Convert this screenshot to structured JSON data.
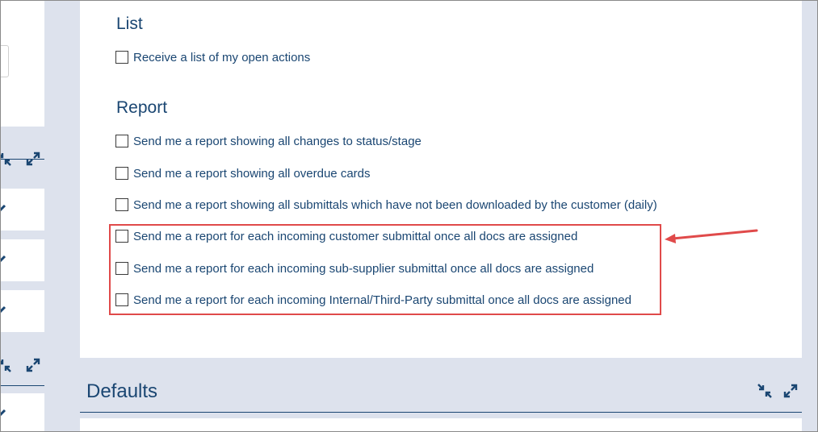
{
  "list_section": {
    "title": "List",
    "options": [
      {
        "label": "Receive a list of my open actions",
        "checked": false
      }
    ]
  },
  "report_section": {
    "title": "Report",
    "options": [
      {
        "label": "Send me a report showing all changes to status/stage",
        "checked": false
      },
      {
        "label": "Send me a report showing all overdue cards",
        "checked": false
      },
      {
        "label": "Send me a report showing all submittals which have not been downloaded by the customer (daily)",
        "checked": false
      },
      {
        "label": "Send me a report for each incoming customer submittal once all docs are assigned",
        "checked": false
      },
      {
        "label": "Send me a report for each incoming sub-supplier submittal once all docs are assigned",
        "checked": false
      },
      {
        "label": "Send me a report for each incoming Internal/Third-Party submittal once all docs are assigned",
        "checked": false
      }
    ]
  },
  "defaults_section": {
    "title": "Defaults"
  },
  "icons": {
    "collapse": "collapse-icon",
    "expand": "expand-icon",
    "edit": "pencil-icon"
  },
  "colors": {
    "primary_text": "#1a4672",
    "background": "#dde2ed",
    "highlight": "#e04a4a"
  }
}
